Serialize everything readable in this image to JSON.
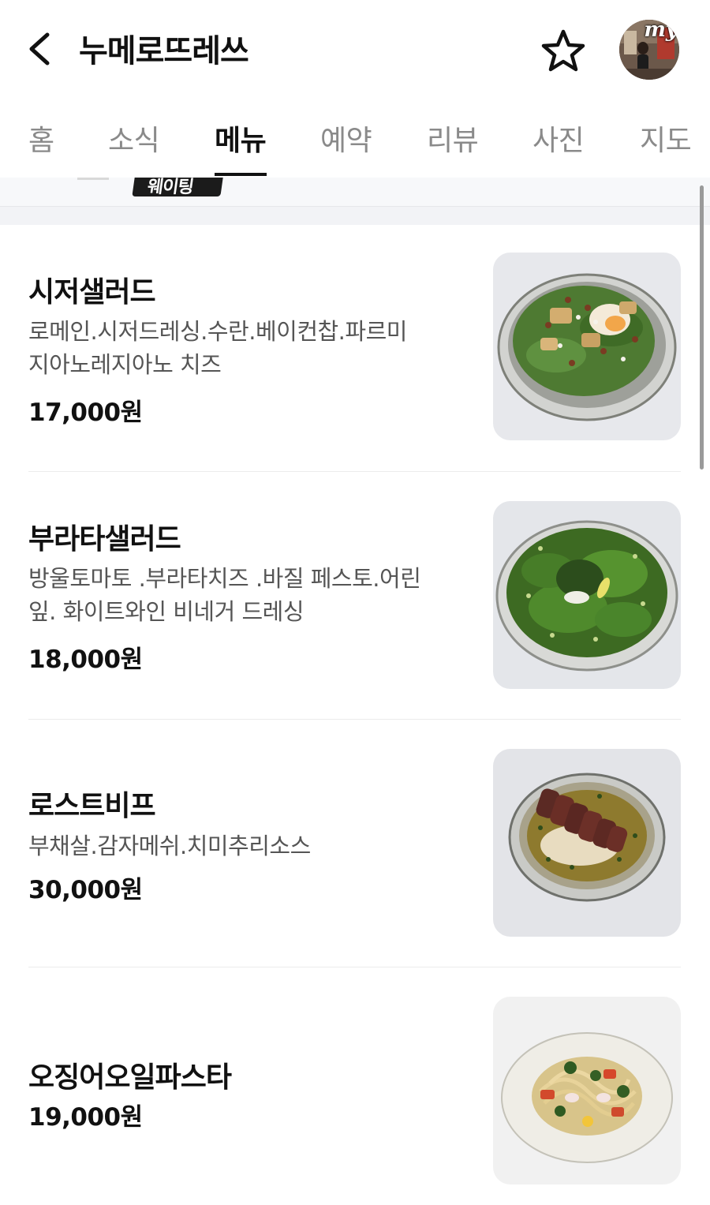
{
  "header": {
    "title": "누메로뜨레쓰",
    "back_icon": "chevron-left-icon",
    "favorite_icon": "star-outline-icon",
    "avatar_badge": "my"
  },
  "tabs": [
    {
      "label": "홈"
    },
    {
      "label": "소식"
    },
    {
      "label": "메뉴",
      "active": true
    },
    {
      "label": "예약"
    },
    {
      "label": "리뷰"
    },
    {
      "label": "사진"
    },
    {
      "label": "지도"
    }
  ],
  "banner": {
    "text": "웨이팅"
  },
  "menu": [
    {
      "name": "시저샐러드",
      "desc1": "로메인.시저드레싱.수란.베이컨찹.파르미",
      "desc2": "지아노레지아노 치즈",
      "price": "17,000원"
    },
    {
      "name": "부라타샐러드",
      "desc1": "방울토마토 .부라타치즈 .바질 페스토.어린",
      "desc2": "잎. 화이트와인 비네거 드레싱",
      "price": "18,000원"
    },
    {
      "name": "로스트비프",
      "desc1": "부채살.감자메쉬.치미추리소스",
      "price": "30,000원"
    },
    {
      "name": "오징어오일파스타",
      "price": "19,000원"
    }
  ],
  "colors": {
    "accent": "#111111",
    "tab_inactive": "#8a8a8a",
    "description": "#555555",
    "divider": "#ececec"
  }
}
